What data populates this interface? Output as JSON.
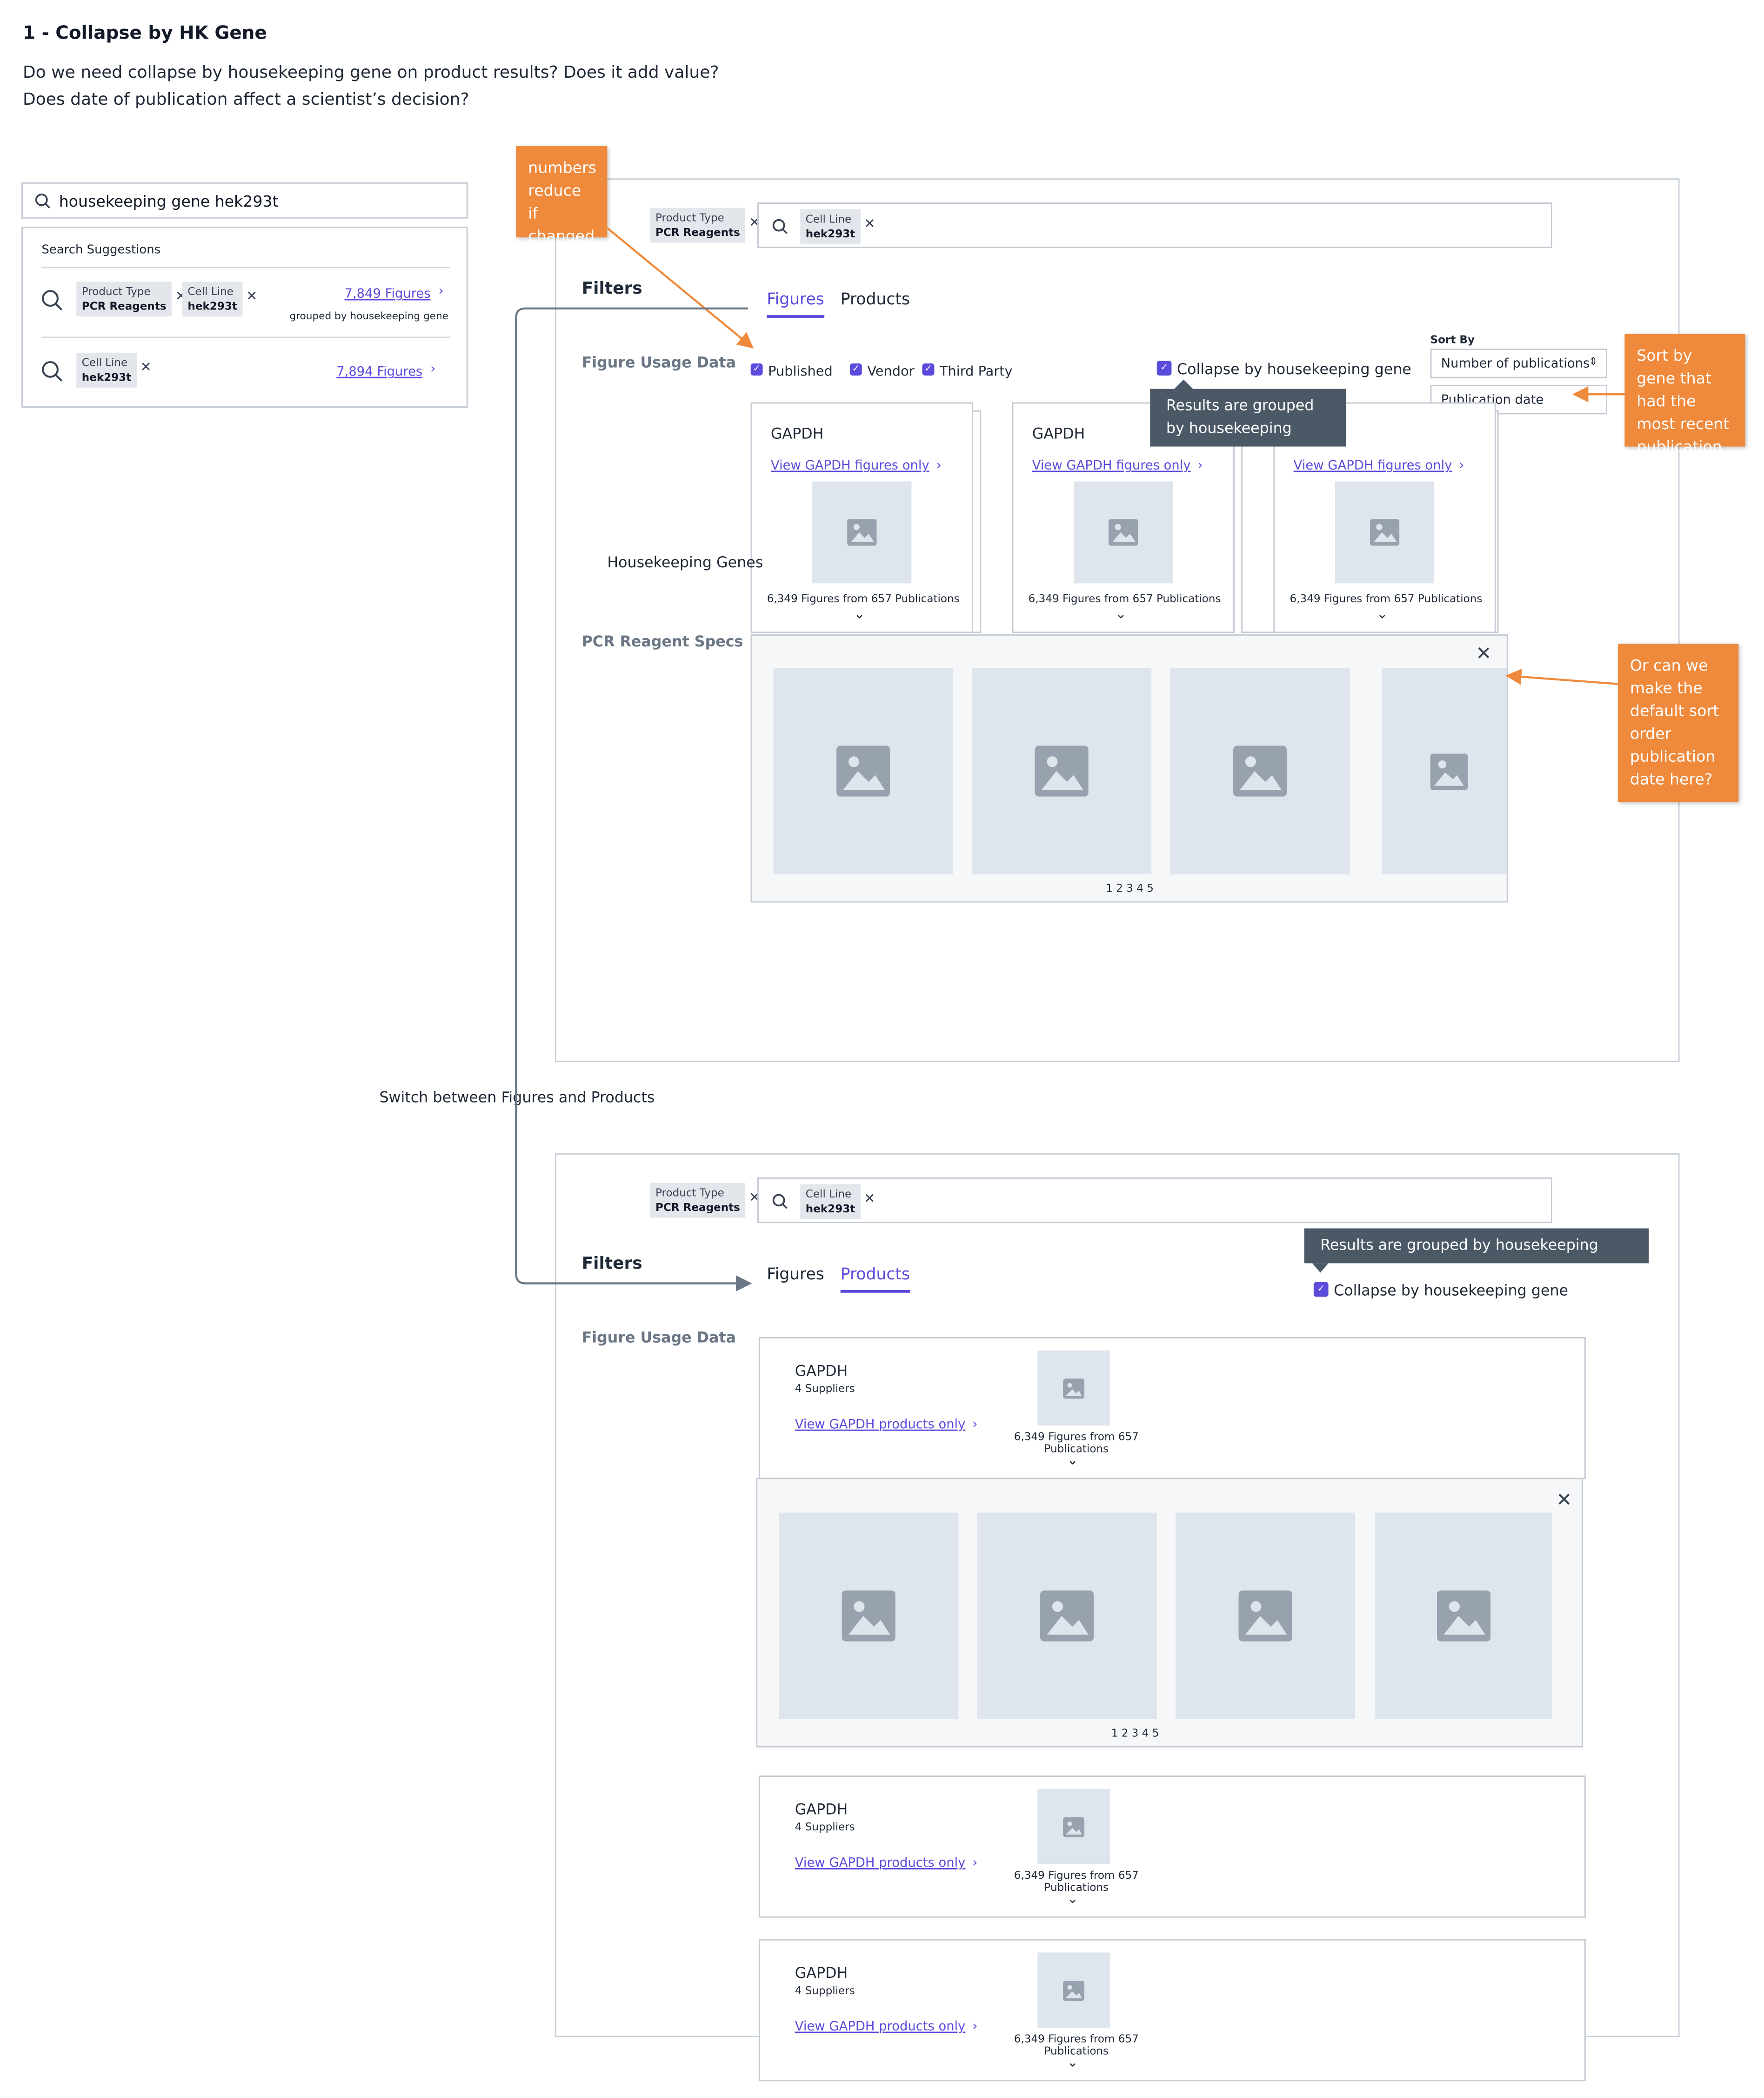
{
  "header": {
    "title": "1 - Collapse by HK Gene",
    "intro_line1": "Do we need collapse by housekeeping gene on product results? Does it add value?",
    "intro_line2": "Does date of publication affect a scientist’s decision?"
  },
  "search": {
    "query": "housekeeping gene hek293t",
    "suggestions_title": "Search Suggestions",
    "suggestions": [
      {
        "chip1_label": "Product Type",
        "chip1_value": "PCR Reagents",
        "chip2_label": "Cell Line",
        "chip2_value": "hek293t",
        "count": "7,849 Figures",
        "sub": "grouped by housekeeping gene"
      },
      {
        "chip1_label": "Cell Line",
        "chip1_value": "hek293t",
        "count": "7,894 Figures"
      }
    ]
  },
  "figures_view": {
    "filter_chip_label": "Product Type",
    "filter_chip_value": "PCR Reagents",
    "query_chip_label": "Cell Line",
    "query_chip_value": "hek293t",
    "filters_heading": "Filters",
    "tabs": [
      "Figures",
      "Products"
    ],
    "active_tab": "Figures",
    "figure_usage_label": "Figure Usage Data",
    "checkboxes": [
      "Published",
      "Vendor",
      "Third Party"
    ],
    "collapse_label": "Collapse by housekeeping gene",
    "tooltip_line1": "Results are grouped",
    "tooltip_line2": "by housekeeping gene",
    "sort_by_label": "Sort By",
    "sort_selected": "Number of publications",
    "sort_option": "Publication date",
    "housekeeping_label": "Housekeeping Genes",
    "pcr_specs_label": "PCR Reagent Specs",
    "gene_cards": [
      {
        "gene": "GAPDH",
        "link": "View GAPDH figures only",
        "caption": "6,349 Figures from 657 Publications"
      },
      {
        "gene": "GAPDH",
        "link": "View GAPDH figures only",
        "caption": "6,349 Figures from 657 Publications"
      },
      {
        "gene": "",
        "link": "View GAPDH figures only",
        "caption": "6,349 Figures from 657 Publications"
      }
    ],
    "pager": "1 2 3 4 5"
  },
  "products_view": {
    "filter_chip_label": "Product Type",
    "filter_chip_value": "PCR Reagents",
    "query_chip_label": "Cell Line",
    "query_chip_value": "hek293t",
    "filters_heading": "Filters",
    "tabs": [
      "Figures",
      "Products"
    ],
    "active_tab": "Products",
    "figure_usage_label": "Figure Usage Data",
    "tooltip": "Results are grouped by housekeeping gene",
    "collapse_label": "Collapse by housekeeping gene",
    "product_cards": [
      {
        "gene": "GAPDH",
        "suppliers": "4 Suppliers",
        "link": "View GAPDH products only",
        "caption_line1": "6,349 Figures from 657",
        "caption_line2": "Publications"
      },
      {
        "gene": "GAPDH",
        "suppliers": "4 Suppliers",
        "link": "View GAPDH products only",
        "caption_line1": "6,349 Figures from 657",
        "caption_line2": "Publications"
      },
      {
        "gene": "GAPDH",
        "suppliers": "4 Suppliers",
        "link": "View GAPDH products only",
        "caption_line1": "6,349 Figures from 657",
        "caption_line2": "Publications"
      }
    ],
    "pager": "1 2 3 4 5"
  },
  "annotations": {
    "numbers_note": "numbers reduce if changed",
    "sort_note": "Sort by gene that had the most recent publication",
    "default_sort_note": "Or can we make the default sort order publication date here?",
    "switch_label": "Switch between Figures and Products"
  },
  "colors": {
    "accent": "#5b4bdb",
    "note": "#ef8a3c",
    "tooltip": "#4b5866",
    "placeholder": "#dfe5ec"
  }
}
